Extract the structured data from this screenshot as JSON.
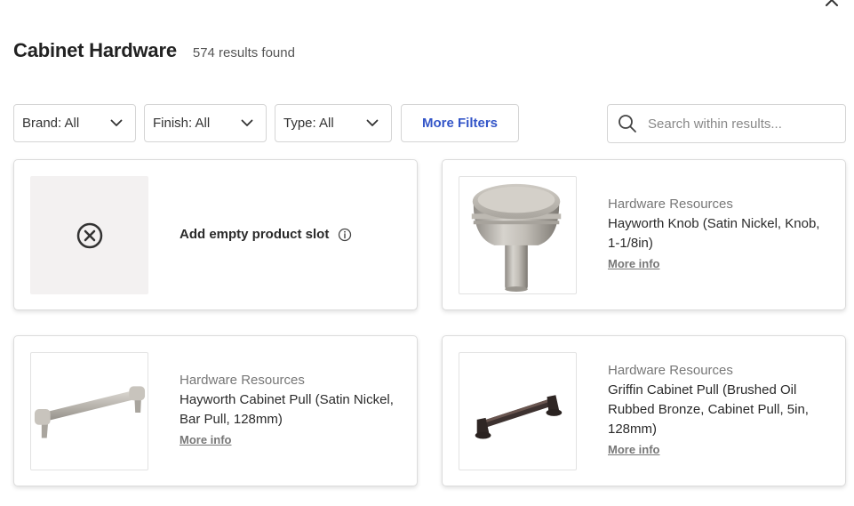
{
  "header": {
    "title": "Cabinet Hardware",
    "results": "574 results found"
  },
  "filters": {
    "brand_label": "Brand: All",
    "finish_label": "Finish: All",
    "type_label": "Type: All",
    "more_filters_label": "More Filters"
  },
  "search": {
    "placeholder": "Search within results..."
  },
  "empty_slot": {
    "label": "Add empty product slot"
  },
  "products": [
    {
      "brand": "Hardware Resources",
      "name": "Hayworth Knob (Satin Nickel, Knob, 1-1/8in)",
      "more_info": "More info"
    },
    {
      "brand": "Hardware Resources",
      "name": "Hayworth Cabinet Pull (Satin Nickel, Bar Pull, 128mm)",
      "more_info": "More info"
    },
    {
      "brand": "Hardware Resources",
      "name": "Griffin Cabinet Pull (Brushed Oil Rubbed Bronze, Cabinet Pull, 5in, 128mm)",
      "more_info": "More info"
    }
  ],
  "icons": {
    "close": "close-icon",
    "chevron": "chevron-down-icon",
    "search": "search-icon",
    "remove": "circle-x-icon",
    "info": "info-icon"
  },
  "colors": {
    "accent": "#3355c8",
    "muted_text": "#777777",
    "border": "#d5d5d5",
    "empty_slot_bg": "#f3f1f1"
  }
}
